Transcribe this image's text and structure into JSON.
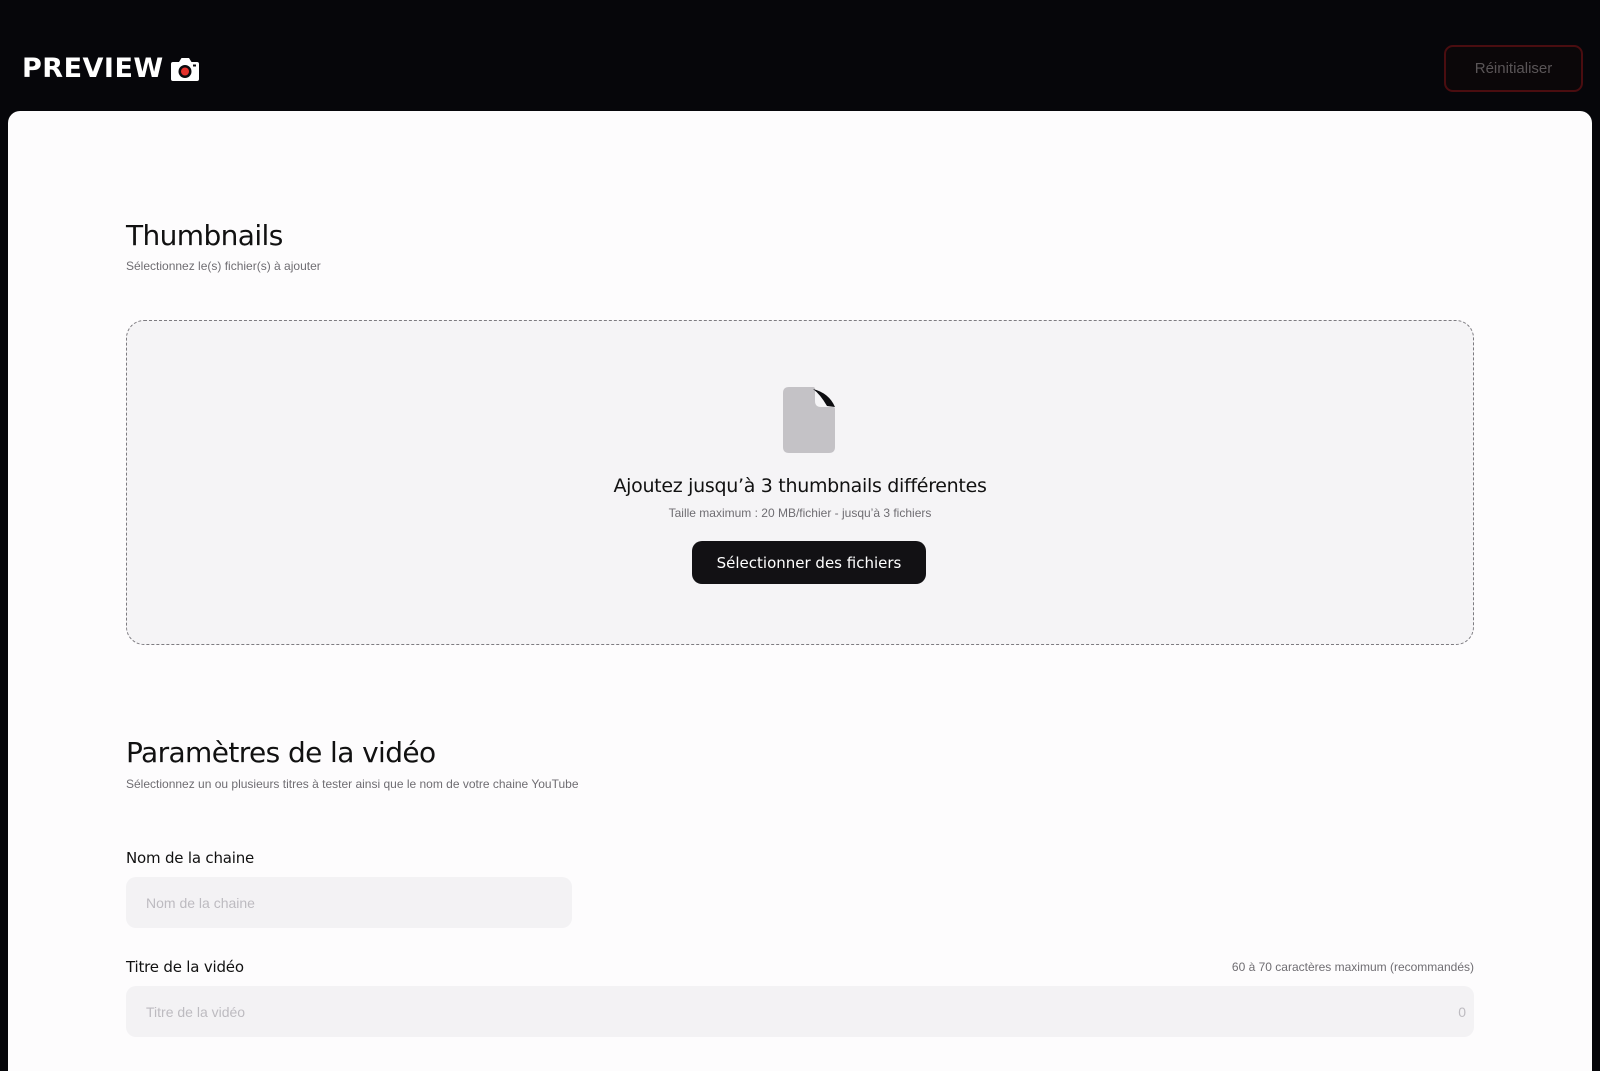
{
  "header": {
    "logo_text": "PREVIEW",
    "reset_label": "Réinitialiser"
  },
  "thumbnails": {
    "title": "Thumbnails",
    "subtitle": "Sélectionnez le(s) fichier(s) à ajouter",
    "dropzone": {
      "title": "Ajoutez jusqu’à 3 thumbnails différentes",
      "subtitle": "Taille maximum : 20 MB/fichier - jusqu’à 3 fichiers",
      "button_label": "Sélectionner des fichiers",
      "icon": "file-icon"
    }
  },
  "video_settings": {
    "title": "Paramètres de la vidéo",
    "subtitle": "Sélectionnez un ou plusieurs titres à tester ainsi que le nom de votre chaine YouTube",
    "channel": {
      "label": "Nom de la chaine",
      "placeholder": "Nom de la chaine",
      "value": ""
    },
    "video_title": {
      "label": "Titre de la vidéo",
      "hint": "60 à 70 caractères maximum (recommandés)",
      "placeholder": "Titre de la vidéo",
      "value": "",
      "char_count": "0"
    }
  },
  "colors": {
    "background": "#06060a",
    "card": "#fdfcfd",
    "primary_button": "#121114",
    "logo_accent": "#e5302b",
    "reset_border": "#4a0d10"
  }
}
